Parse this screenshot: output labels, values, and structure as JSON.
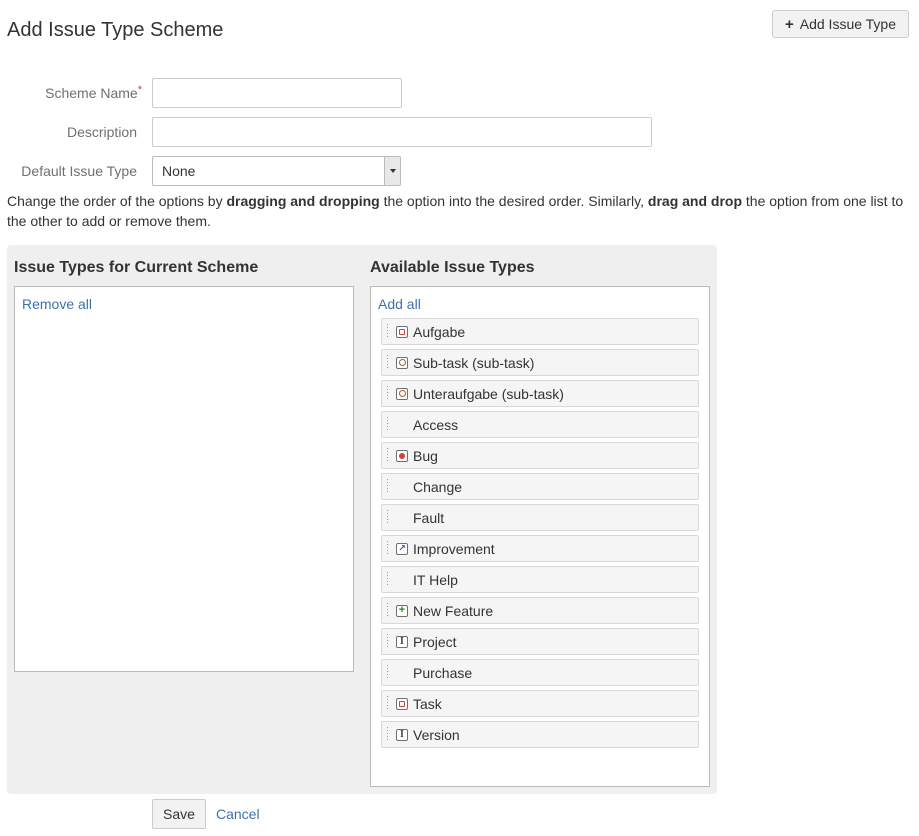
{
  "page": {
    "title": "Add Issue Type Scheme",
    "add_type_button": "Add Issue Type"
  },
  "form": {
    "scheme_name": {
      "label": "Scheme Name",
      "required_marker": "*",
      "value": ""
    },
    "description": {
      "label": "Description",
      "value": ""
    },
    "default_issue_type": {
      "label": "Default Issue Type",
      "selected": "None"
    }
  },
  "instructions": {
    "part1": "Change the order of the options by ",
    "bold1": "dragging and dropping",
    "part2": " the option into the desired order. Similarly, ",
    "bold2": "drag and drop",
    "part3": " the option from one list to the other to add or remove them."
  },
  "current_scheme": {
    "title": "Issue Types for Current Scheme",
    "remove_all": "Remove all",
    "items": []
  },
  "available": {
    "title": "Available Issue Types",
    "add_all": "Add all",
    "items": [
      {
        "label": "Aufgabe",
        "icon": "task-icon"
      },
      {
        "label": "Sub-task (sub-task)",
        "icon": "subtask-icon"
      },
      {
        "label": "Unteraufgabe (sub-task)",
        "icon": "subtask-icon"
      },
      {
        "label": "Access",
        "icon": ""
      },
      {
        "label": "Bug",
        "icon": "bug-icon"
      },
      {
        "label": "Change",
        "icon": ""
      },
      {
        "label": "Fault",
        "icon": ""
      },
      {
        "label": "Improvement",
        "icon": "improvement-icon"
      },
      {
        "label": "IT Help",
        "icon": ""
      },
      {
        "label": "New Feature",
        "icon": "new-feature-icon"
      },
      {
        "label": "Project",
        "icon": "project-icon"
      },
      {
        "label": "Purchase",
        "icon": ""
      },
      {
        "label": "Task",
        "icon": "task-icon"
      },
      {
        "label": "Version",
        "icon": "project-icon"
      }
    ]
  },
  "actions": {
    "save": "Save",
    "cancel": "Cancel"
  },
  "colors": {
    "link": "#3b73af",
    "required": "#d04437",
    "panel_bg": "#efefef"
  }
}
